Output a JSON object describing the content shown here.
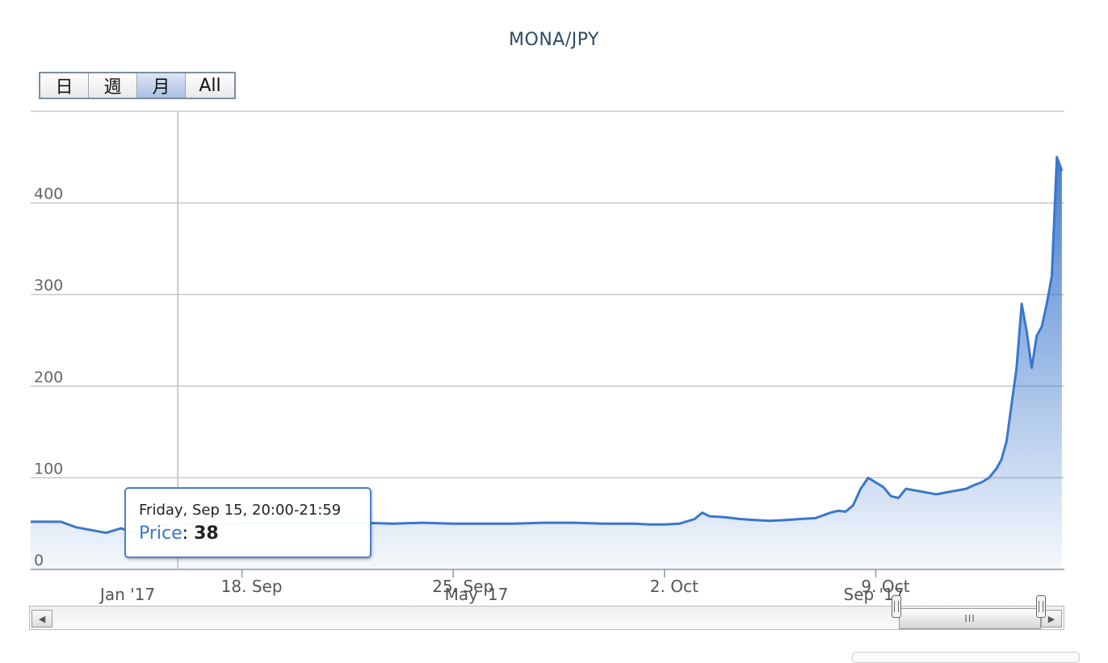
{
  "chart_data": {
    "type": "area",
    "title": "MONA/JPY",
    "series": [
      {
        "name": "Price",
        "color": "#3a77cc",
        "x": [
          "2017-09-11 00:00",
          "2017-09-11 12:00",
          "2017-09-12 00:00",
          "2017-09-12 12:00",
          "2017-09-13 00:00",
          "2017-09-13 12:00",
          "2017-09-14 00:00",
          "2017-09-14 12:00",
          "2017-09-15 00:00",
          "2017-09-15 12:00",
          "2017-09-15 21:00",
          "2017-09-16 00:00",
          "2017-09-16 12:00",
          "2017-09-17 00:00",
          "2017-09-17 12:00",
          "2017-09-18 00:00",
          "2017-09-19 00:00",
          "2017-09-20 00:00",
          "2017-09-21 00:00",
          "2017-09-22 00:00",
          "2017-09-23 00:00",
          "2017-09-24 00:00",
          "2017-09-25 00:00",
          "2017-09-26 00:00",
          "2017-09-27 00:00",
          "2017-09-28 00:00",
          "2017-09-29 00:00",
          "2017-09-30 00:00",
          "2017-10-01 00:00",
          "2017-10-01 12:00",
          "2017-10-02 00:00",
          "2017-10-02 12:00",
          "2017-10-03 00:00",
          "2017-10-03 06:00",
          "2017-10-03 12:00",
          "2017-10-04 00:00",
          "2017-10-04 12:00",
          "2017-10-05 00:00",
          "2017-10-05 12:00",
          "2017-10-06 00:00",
          "2017-10-06 12:00",
          "2017-10-07 00:00",
          "2017-10-07 12:00",
          "2017-10-07 18:00",
          "2017-10-08 00:00",
          "2017-10-08 06:00",
          "2017-10-08 12:00",
          "2017-10-08 18:00",
          "2017-10-09 00:00",
          "2017-10-09 06:00",
          "2017-10-09 12:00",
          "2017-10-09 18:00",
          "2017-10-10 00:00",
          "2017-10-10 12:00",
          "2017-10-11 00:00",
          "2017-10-11 12:00",
          "2017-10-12 00:00",
          "2017-10-12 06:00",
          "2017-10-12 12:00",
          "2017-10-12 18:00",
          "2017-10-13 00:00",
          "2017-10-13 04:00",
          "2017-10-13 08:00",
          "2017-10-13 12:00",
          "2017-10-13 16:00",
          "2017-10-13 20:00",
          "2017-10-14 00:00",
          "2017-10-14 04:00",
          "2017-10-14 08:00",
          "2017-10-14 12:00",
          "2017-10-14 16:00",
          "2017-10-14 20:00",
          "2017-10-15 00:00",
          "2017-10-15 04:00"
        ],
        "values": [
          52,
          52,
          52,
          46,
          43,
          40,
          45,
          38,
          48,
          49,
          38,
          49,
          51,
          50,
          49,
          51,
          51,
          51,
          51,
          51,
          50,
          51,
          50,
          50,
          50,
          51,
          51,
          50,
          50,
          49,
          49,
          50,
          55,
          62,
          58,
          57,
          55,
          54,
          53,
          54,
          55,
          56,
          62,
          64,
          63,
          70,
          88,
          100,
          95,
          90,
          80,
          78,
          88,
          85,
          82,
          85,
          88,
          92,
          95,
          100,
          110,
          120,
          140,
          180,
          220,
          290,
          260,
          220,
          255,
          265,
          290,
          320,
          450,
          435
        ]
      }
    ],
    "x_axis": {
      "tick_labels": [
        "18. Sep",
        "25. Sep",
        "2. Oct",
        "9. Oct"
      ],
      "range": [
        "2017-09-11 00:00",
        "2017-10-15 06:00"
      ]
    },
    "y_axis": {
      "tick_labels": [
        "0",
        "100",
        "200",
        "300",
        "400"
      ],
      "range": [
        0,
        500
      ],
      "grid": true
    },
    "navigator": {
      "tick_labels": [
        "Jan '17",
        "May '17",
        "Sep '17"
      ]
    }
  },
  "range_selector": {
    "buttons": [
      "日",
      "週",
      "月",
      "All"
    ],
    "selected": "月"
  },
  "tooltip": {
    "date_text": "Friday, Sep 15, 20:00-21:59",
    "series_label": "Price",
    "value_text": "38"
  },
  "scrollbar": {
    "left_arrow": "◀",
    "right_arrow": "▶",
    "thumb_grip": "III"
  }
}
